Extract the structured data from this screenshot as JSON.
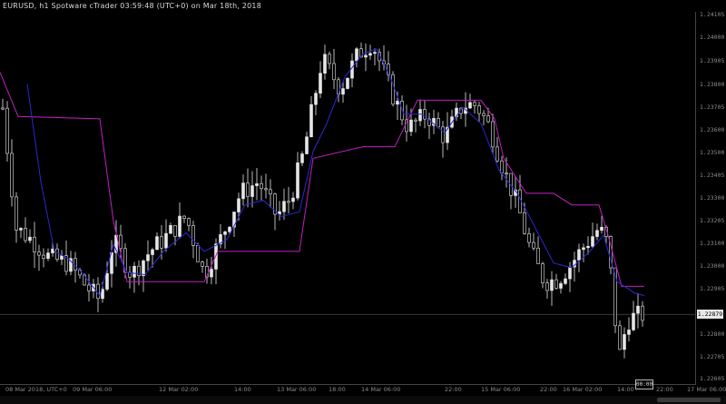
{
  "window": {
    "title": "EURUSD, h1 Spotware cTrader 03:59:48 (UTC+0) on Mar 18th, 2018"
  },
  "price_axis": {
    "labels": [
      "1.24105",
      "1.24000",
      "1.23905",
      "1.23800",
      "1.23705",
      "1.23600",
      "1.23500",
      "1.23405",
      "1.23300",
      "1.23205",
      "1.23100",
      "1.23000",
      "1.22905",
      "1.22800",
      "1.22705",
      "1.22605"
    ],
    "current_price": "1.22879"
  },
  "time_axis": {
    "labels": [
      "08 Mar 2018, UTC+0",
      "09 Mar 06:00",
      "12 Mar 02:00",
      "14:00",
      "13 Mar 06:00",
      "18:00",
      "14 Mar 06:00",
      "22:00",
      "15 Mar 06:00",
      "22:00",
      "16 Mar 02:00",
      "14:00",
      "22:00",
      "17 Mar 06:00"
    ]
  },
  "countdown": "00:00",
  "colors": {
    "background": "#000000",
    "candle": "#e6e6e6",
    "indicator_slow": "#c020c0",
    "indicator_fast": "#2a2ad0",
    "grid_line": "#3a3a3a"
  },
  "chart_data": {
    "type": "candlestick",
    "symbol": "EURUSD",
    "timeframe": "h1",
    "ylim": [
      1.2258,
      1.2418
    ],
    "current_price": 1.22879,
    "anchors": [
      [
        0,
        1.2387
      ],
      [
        18,
        1.2325
      ],
      [
        35,
        1.232
      ],
      [
        55,
        1.2312
      ],
      [
        75,
        1.231
      ],
      [
        95,
        1.23
      ],
      [
        110,
        1.2294
      ],
      [
        125,
        1.232
      ],
      [
        145,
        1.2305
      ],
      [
        165,
        1.2315
      ],
      [
        185,
        1.2322
      ],
      [
        205,
        1.233
      ],
      [
        225,
        1.2305
      ],
      [
        245,
        1.2322
      ],
      [
        265,
        1.234
      ],
      [
        285,
        1.2345
      ],
      [
        305,
        1.233
      ],
      [
        320,
        1.2338
      ],
      [
        335,
        1.2358
      ],
      [
        345,
        1.2378
      ],
      [
        355,
        1.2398
      ],
      [
        375,
        1.2385
      ],
      [
        395,
        1.24
      ],
      [
        410,
        1.2405
      ],
      [
        420,
        1.2395
      ],
      [
        435,
        1.238
      ],
      [
        450,
        1.2368
      ],
      [
        470,
        1.2374
      ],
      [
        490,
        1.2364
      ],
      [
        510,
        1.2378
      ],
      [
        525,
        1.2378
      ],
      [
        540,
        1.2368
      ],
      [
        555,
        1.235
      ],
      [
        570,
        1.2335
      ],
      [
        585,
        1.2315
      ],
      [
        600,
        1.2302
      ],
      [
        615,
        1.2303
      ],
      [
        630,
        1.231
      ],
      [
        645,
        1.2318
      ],
      [
        660,
        1.2325
      ],
      [
        670,
        1.2318
      ],
      [
        678,
        1.2285
      ],
      [
        684,
        1.2268
      ],
      [
        690,
        1.2285
      ],
      [
        700,
        1.2287
      ],
      [
        710,
        1.2288
      ]
    ],
    "series": [
      {
        "name": "",
        "type": "line",
        "values": [
          [
            0,
            1.2392
          ],
          [
            20,
            1.2373
          ],
          [
            110,
            1.2372
          ],
          [
            125,
            1.2328
          ],
          [
            140,
            1.2302
          ],
          [
            225,
            1.2302
          ],
          [
            240,
            1.2315
          ],
          [
            330,
            1.2315
          ],
          [
            345,
            1.2355
          ],
          [
            400,
            1.236
          ],
          [
            435,
            1.236
          ],
          [
            460,
            1.238
          ],
          [
            530,
            1.238
          ],
          [
            545,
            1.2372
          ],
          [
            555,
            1.2355
          ],
          [
            580,
            1.234
          ],
          [
            610,
            1.234
          ],
          [
            630,
            1.2335
          ],
          [
            660,
            1.2335
          ],
          [
            670,
            1.2322
          ],
          [
            685,
            1.23
          ],
          [
            710,
            1.23
          ]
        ]
      },
      {
        "name": "",
        "type": "line",
        "values": [
          [
            30,
            1.2387
          ],
          [
            45,
            1.2345
          ],
          [
            60,
            1.2315
          ],
          [
            75,
            1.2312
          ],
          [
            90,
            1.2306
          ],
          [
            110,
            1.2296
          ],
          [
            125,
            1.2318
          ],
          [
            140,
            1.2306
          ],
          [
            160,
            1.2305
          ],
          [
            180,
            1.2315
          ],
          [
            205,
            1.2323
          ],
          [
            225,
            1.2315
          ],
          [
            250,
            1.232
          ],
          [
            270,
            1.2335
          ],
          [
            290,
            1.2337
          ],
          [
            310,
            1.233
          ],
          [
            330,
            1.2332
          ],
          [
            345,
            1.2358
          ],
          [
            360,
            1.237
          ],
          [
            380,
            1.239
          ],
          [
            400,
            1.24
          ],
          [
            415,
            1.2402
          ],
          [
            430,
            1.239
          ],
          [
            445,
            1.2374
          ],
          [
            465,
            1.2374
          ],
          [
            490,
            1.2366
          ],
          [
            510,
            1.2377
          ],
          [
            530,
            1.237
          ],
          [
            550,
            1.235
          ],
          [
            570,
            1.234
          ],
          [
            590,
            1.2325
          ],
          [
            610,
            1.231
          ],
          [
            630,
            1.2308
          ],
          [
            650,
            1.2315
          ],
          [
            665,
            1.2322
          ],
          [
            680,
            1.2302
          ],
          [
            700,
            1.2297
          ],
          [
            710,
            1.2296
          ]
        ]
      }
    ]
  }
}
